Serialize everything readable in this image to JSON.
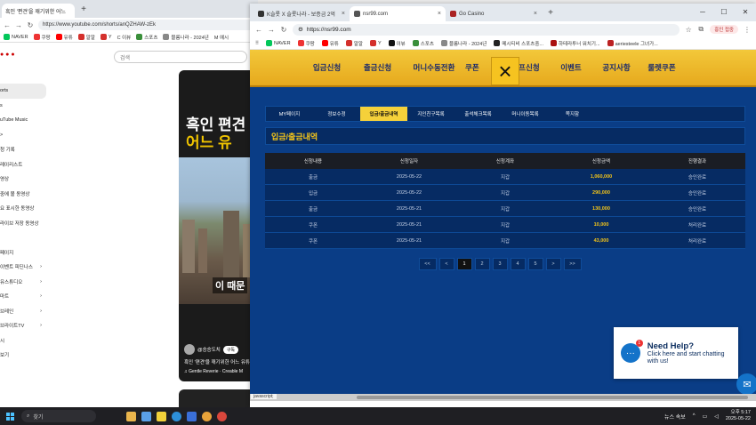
{
  "back_window": {
    "tab_title": "흑인 '편견'을 깨기위한 어느",
    "url": "https://www.youtube.com/shorts/anQZHAW-zEk",
    "bookmarks": [
      "NAVER",
      "쿠팡",
      "유튜",
      "알알",
      "Y",
      "C 이뷰",
      "스포츠",
      "블룸나라 - 2024년",
      "M 예시"
    ],
    "search_placeholder": "검색",
    "sidebar_items": [
      "orts",
      "s",
      "uTube Music",
      ">",
      "청 기록",
      "레이리스트",
      "영상",
      "중에 볼 동영상",
      "요 표시한 동영상",
      "라이브 저장 동영상",
      "",
      "페이지",
      "이벤트 피딘나스",
      "유스튜디오",
      "마트",
      "브레인",
      "브라이트TV",
      "시",
      "보기"
    ],
    "short": {
      "headline_1": "흑인 편견",
      "headline_2": "어느 유",
      "caption": "이 때문",
      "author": "@승승도치",
      "subscribe": "구독",
      "title": "흑인 '편견'을 깨기위한 어느 유튜",
      "music": "♫ Gentle Reverie · Creable M"
    }
  },
  "front_window": {
    "tabs": [
      {
        "title": "K슬롯 X 슬롯나라 - 보증금 2억",
        "active": false
      },
      {
        "title": "nsr99.com",
        "active": true
      },
      {
        "title": "Go Casino",
        "active": false
      }
    ],
    "url": "https://nsr99.com",
    "profile_label": "흥인 접중",
    "bookmarks": [
      "NAVER",
      "쿠팡",
      "유튜",
      "알알",
      "Y",
      "이뷰",
      "스포츠",
      "블룸나라 - 2024년",
      "메시티비 스포츠중...",
      "하테라투너 워치기...",
      "aeriesteele 그녀가..."
    ],
    "status_text": "javascript;"
  },
  "site": {
    "nav_items": [
      "입금신청",
      "출금신청",
      "머니수동전환",
      "쿠폰",
      "콤프신청",
      "이벤트",
      "공지사항",
      "룰렛쿠폰"
    ],
    "close_icon": "×",
    "subtabs": [
      {
        "label": "MY페이지",
        "active": false
      },
      {
        "label": "정보수정",
        "active": false
      },
      {
        "label": "입금/출금내역",
        "active": true
      },
      {
        "label": "지인친구목록",
        "active": false
      },
      {
        "label": "출석체크목록",
        "active": false
      },
      {
        "label": "머니이동목록",
        "active": false
      },
      {
        "label": "쪽지함",
        "active": false
      }
    ],
    "section_title": "입금/출금내역",
    "table": {
      "headers": [
        "신청내용",
        "신청일자",
        "신청계좌",
        "신청금액",
        "진행결과"
      ],
      "rows": [
        [
          "출금",
          "2025-05-22",
          "지갑",
          "1,060,000",
          "승인완료"
        ],
        [
          "입금",
          "2025-05-22",
          "지갑",
          "290,000",
          "승인완료"
        ],
        [
          "출금",
          "2025-05-21",
          "지갑",
          "130,000",
          "승인완료"
        ],
        [
          "쿠폰",
          "2025-05-21",
          "지갑",
          "10,000",
          "처리완료"
        ],
        [
          "쿠폰",
          "2025-05-21",
          "지갑",
          "43,000",
          "처리완료"
        ]
      ]
    },
    "pagination": {
      "first": "<<",
      "prev": "<",
      "pages": [
        "1",
        "2",
        "3",
        "4",
        "5"
      ],
      "next": ">",
      "last": ">>",
      "current": "1"
    },
    "help_widget": {
      "title": "Need Help?",
      "subtitle": "Click here and start chatting with us!",
      "badge": "1"
    }
  },
  "taskbar": {
    "search_placeholder": "찾기",
    "news": "뉴스 속보",
    "time": "오후 5:17",
    "date": "2025-05-22"
  },
  "colors": {
    "site_bg": "#0a3d86",
    "nav_gold": "#f3c83a",
    "accent_yellow": "#f5c518",
    "active_tab": "#f5d13a"
  }
}
